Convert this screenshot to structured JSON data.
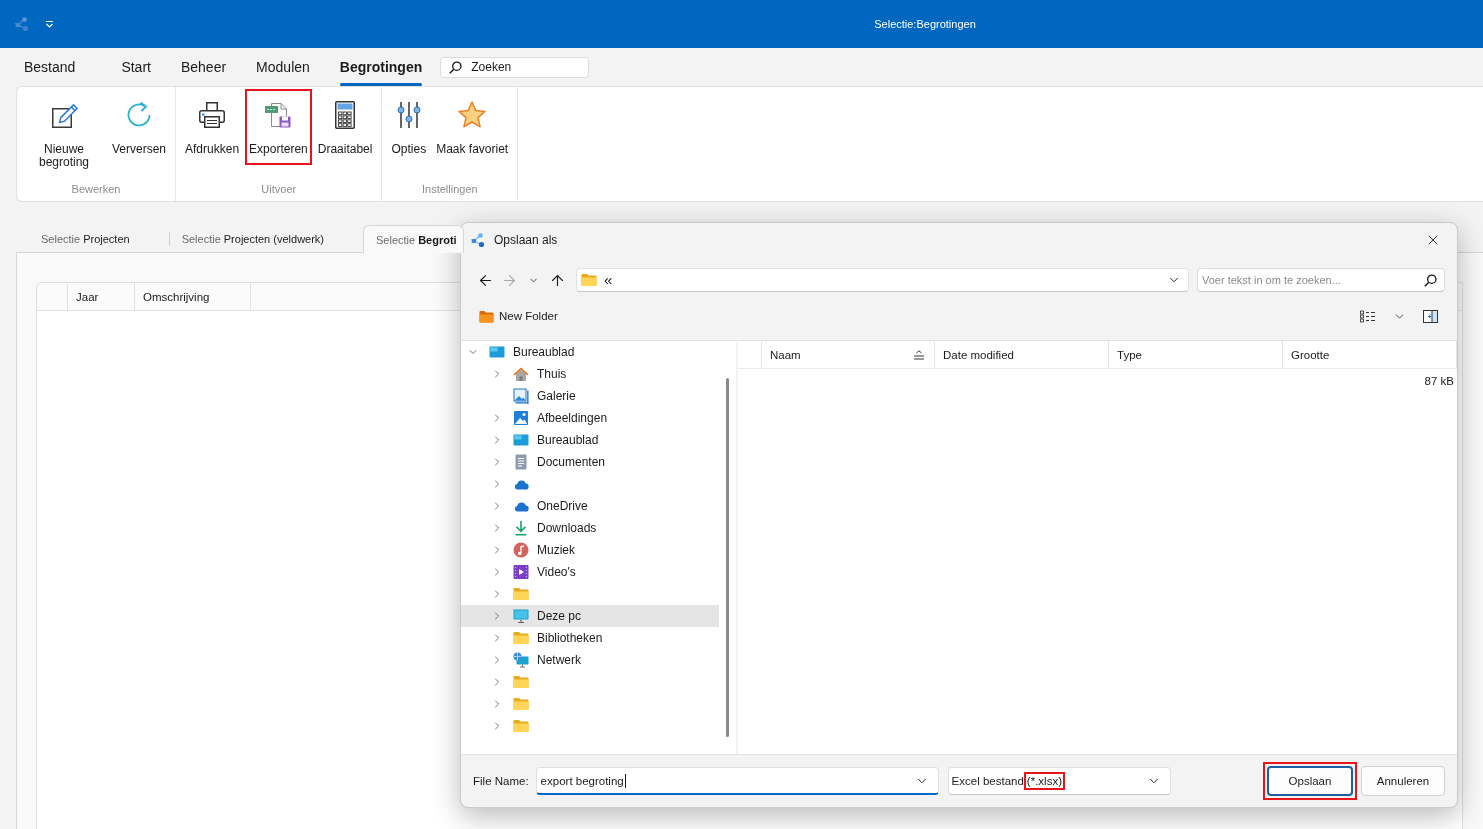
{
  "title_bar": {
    "title": "Selectie:Begrotingen"
  },
  "menu": {
    "tabs": [
      {
        "label": "Bestand",
        "selected": false
      },
      {
        "label": "Start",
        "selected": false
      },
      {
        "label": "Beheer",
        "selected": false
      },
      {
        "label": "Modulen",
        "selected": false
      },
      {
        "label": "Begrotingen",
        "selected": true
      }
    ],
    "search": {
      "placeholder": "Zoeken"
    }
  },
  "ribbon": {
    "groups": [
      {
        "label": "Bewerken",
        "buttons": [
          {
            "label": "Nieuwe begroting",
            "kind": "edit",
            "highlighted": false
          },
          {
            "label": "Verversen",
            "kind": "refresh",
            "highlighted": false
          }
        ]
      },
      {
        "label": "Uitvoer",
        "buttons": [
          {
            "label": "Afdrukken",
            "kind": "print",
            "highlighted": false
          },
          {
            "label": "Exporteren",
            "kind": "export",
            "highlighted": true
          },
          {
            "label": "Draaitabel",
            "kind": "pivot",
            "highlighted": false
          }
        ]
      },
      {
        "label": "Instellingen",
        "buttons": [
          {
            "label": "Opties",
            "kind": "options",
            "highlighted": false
          },
          {
            "label": "Maak favoriet",
            "kind": "favorite",
            "highlighted": false
          }
        ]
      }
    ]
  },
  "document_tabs": [
    {
      "prefix": "Selectie",
      "name": "Projecten",
      "selected": false
    },
    {
      "prefix": "Selectie",
      "name": "Projecten (veldwerk)",
      "selected": false
    },
    {
      "prefix": "Selectie",
      "name": "Begroti",
      "selected": true
    }
  ],
  "table": {
    "columns": [
      "Jaar",
      "Omschrijving"
    ]
  },
  "dialog": {
    "title": "Opslaan als",
    "nav_buttons": [
      {
        "kind": "back",
        "disabled": false
      },
      {
        "kind": "forward",
        "disabled": true
      },
      {
        "kind": "recent",
        "disabled": false
      },
      {
        "kind": "up",
        "disabled": false
      }
    ],
    "address": {
      "value": "«"
    },
    "search": {
      "placeholder": "Voer tekst in om te zoeken..."
    },
    "new_folder": {
      "label": "New Folder"
    },
    "tree": [
      {
        "label": "Bureaublad",
        "kind": "desktop",
        "expandable": true,
        "expanded": true,
        "selected": false,
        "children": [
          {
            "label": "Thuis",
            "kind": "home",
            "expandable": true,
            "expanded": false,
            "selected": false
          },
          {
            "label": "Galerie",
            "kind": "gallery",
            "expandable": false,
            "expanded": false,
            "selected": false
          },
          {
            "label": "Afbeeldingen",
            "kind": "pictures",
            "expandable": true,
            "expanded": false,
            "selected": false
          },
          {
            "label": "Bureaublad",
            "kind": "desktop",
            "expandable": true,
            "expanded": false,
            "selected": false
          },
          {
            "label": "Documenten",
            "kind": "documents",
            "expandable": true,
            "expanded": false,
            "selected": false
          },
          {
            "kind": "cloud",
            "expandable": true,
            "expanded": false,
            "selected": false
          },
          {
            "label": "OneDrive",
            "kind": "cloud",
            "expandable": true,
            "expanded": false,
            "selected": false
          },
          {
            "label": "Downloads",
            "kind": "download",
            "expandable": true,
            "expanded": false,
            "selected": false
          },
          {
            "label": "Muziek",
            "kind": "music",
            "expandable": true,
            "expanded": false,
            "selected": false
          },
          {
            "label": "Video's",
            "kind": "video",
            "expandable": true,
            "expanded": false,
            "selected": false
          },
          {
            "kind": "folder",
            "expandable": true,
            "expanded": false,
            "selected": false
          },
          {
            "label": "Deze pc",
            "kind": "computer",
            "expandable": true,
            "expanded": false,
            "selected": true
          },
          {
            "label": "Bibliotheken",
            "kind": "folder",
            "expandable": true,
            "expanded": false,
            "selected": false
          },
          {
            "label": "Netwerk",
            "kind": "network",
            "expandable": true,
            "expanded": false,
            "selected": false
          },
          {
            "kind": "folder",
            "expandable": true,
            "expanded": false,
            "selected": false
          },
          {
            "kind": "folder",
            "expandable": true,
            "expanded": false,
            "selected": false
          },
          {
            "kind": "folder",
            "expandable": true,
            "expanded": false,
            "selected": false
          }
        ]
      }
    ],
    "columns": [
      {
        "label": "Naam",
        "sorted": true
      },
      {
        "label": "Date modified",
        "sorted": false
      },
      {
        "label": "Type",
        "sorted": false
      },
      {
        "label": "Grootte",
        "sorted": false
      }
    ],
    "files": [
      {
        "size": "87 kB"
      }
    ],
    "file_name": {
      "label": "File Name:",
      "value": "export begroting",
      "focused": true
    },
    "file_type": {
      "name": "Excel bestand",
      "pattern": "(*.xlsx)",
      "pattern_highlighted": true
    },
    "buttons": [
      {
        "label": "Opslaan",
        "kind": "primary",
        "highlighted": true
      },
      {
        "label": "Annuleren",
        "kind": "secondary",
        "highlighted": false
      }
    ]
  }
}
